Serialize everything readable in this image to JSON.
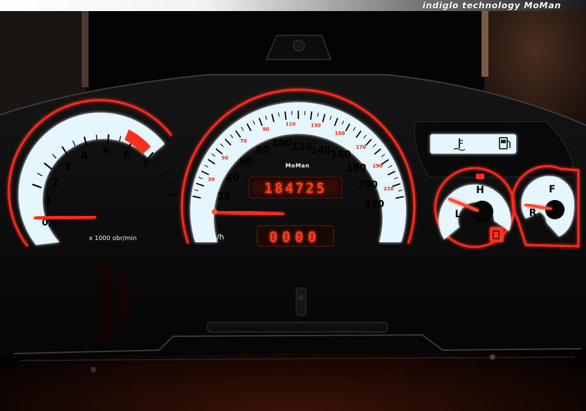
{
  "banner": {
    "caption": "indiglo technology MoMan"
  },
  "tacho": {
    "ticks": [
      "0,5",
      "1",
      "2",
      "3",
      "4",
      "5",
      "6",
      "7"
    ],
    "unit": "x 1000 obr/min",
    "needle_value_rpm_x1000": 0
  },
  "speedo": {
    "major": [
      "20",
      "40",
      "60",
      "80",
      "100",
      "120",
      "140",
      "160",
      "180",
      "200",
      "220"
    ],
    "minor": [
      "30",
      "50",
      "70",
      "90",
      "110",
      "130",
      "150",
      "170",
      "190",
      "210"
    ],
    "unit": "km/h",
    "brand": "MoMan",
    "odometer": "184725",
    "trip": "0000",
    "needle_value_kmh": 20
  },
  "temp_gauge": {
    "high": "H",
    "low": "L"
  },
  "fuel_gauge": {
    "full": "F",
    "reserve": "R"
  },
  "indicator_icons": [
    "coolant-temperature-icon",
    "fuel-pump-icon",
    "low-fuel-warning-icon"
  ],
  "colors": {
    "dial_face": "#e6f6ff",
    "glow_red": "#ff2a1a",
    "needle": "#ff2b16",
    "lcd_red": "#ff3b1e"
  }
}
